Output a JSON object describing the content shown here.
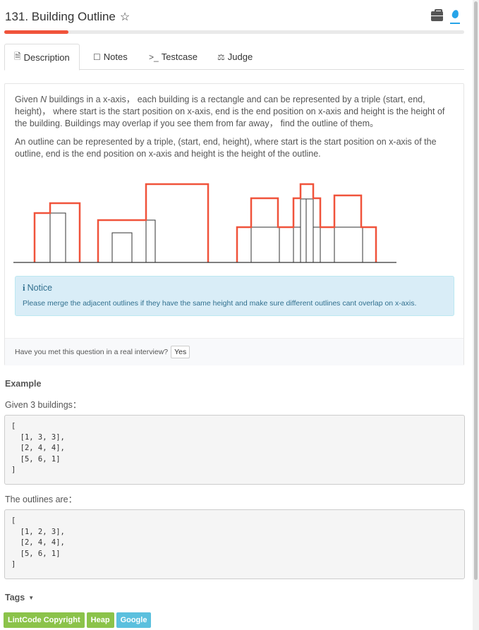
{
  "header": {
    "title": "131. Building Outline",
    "progress_percent": 14
  },
  "tabs": [
    {
      "label": "Description",
      "icon": "document-icon"
    },
    {
      "label": "Notes",
      "icon": "note-icon"
    },
    {
      "label": "Testcase",
      "icon": "terminal-icon"
    },
    {
      "label": "Judge",
      "icon": "scale-icon"
    }
  ],
  "description": {
    "para1_n": "N",
    "para1_rest": " buildings in a x-axis， each building is a rectangle and can be represented by a triple (start, end, height)， where start is the start position on x-axis, end is the end position on x-axis and height is the height of the building. Buildings may overlap if you see them from far away， find the outline of them。",
    "para1_prefix": "Given ",
    "para2": "An outline can be represented by a triple, (start, end, height), where start is the start position on x-axis of the outline, end is the end position on x-axis and height is the height of the outline."
  },
  "notice": {
    "title": "Notice",
    "body": "Please merge the adjacent outlines if they have the same height and make sure different outlines cant overlap on x-axis."
  },
  "interview": {
    "question": "Have you met this question in a real interview?",
    "yes_label": "Yes"
  },
  "example": {
    "title": "Example",
    "given": "Given 3 buildings：",
    "code1": "[\n  [1, 3, 3],\n  [2, 4, 4],\n  [5, 6, 1]\n]",
    "outlines_label": "The outlines are：",
    "code2": "[\n  [1, 2, 3],\n  [2, 4, 4],\n  [5, 6, 1]\n]"
  },
  "tags": {
    "title": "Tags",
    "items": [
      {
        "label": "LintCode Copyright",
        "color": "#8bc34a"
      },
      {
        "label": "Heap",
        "color": "#8bc34a"
      },
      {
        "label": "Google",
        "color": "#5bc0de"
      }
    ]
  },
  "colors": {
    "accent_red": "#f0533b",
    "notice_bg": "#d9edf7",
    "notice_text": "#31708f"
  }
}
